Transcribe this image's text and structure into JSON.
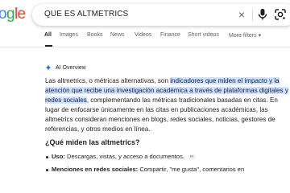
{
  "logo": {
    "part1": "o",
    "part2": "g",
    "part3": "le"
  },
  "search": {
    "query": "QUE ES ALTMETRICS",
    "clear": "×"
  },
  "tabs": [
    {
      "label": "All"
    },
    {
      "label": "Images"
    },
    {
      "label": "Books"
    },
    {
      "label": "News"
    },
    {
      "label": "Videos"
    },
    {
      "label": "Finance"
    },
    {
      "label": "Short videos"
    },
    {
      "label": "More filters"
    }
  ],
  "ai_overview": {
    "title": "AI Overview",
    "intro": "Las altmetrics, o métricas alternativas, son ",
    "highlight": "indicadores que miden el impacto y la atención que recibe una investigación académica a través de plataformas digitales y redes sociales",
    "rest": ", complementando las métricas tradicionales basadas en citas. En lugar de enfocarse únicamente en las citas en publicaciones académicas, las altmetrics consideran menciones en blogs, redes sociales, noticias, gestores de referencias, y otros medios en línea.",
    "question": "¿Qué miden las altmetrics?",
    "bullets": [
      {
        "term": "Uso:",
        "text": " Descargas, vistas, y acceso a documentos."
      },
      {
        "term": "Menciones en redes sociales:",
        "text": " Compartir, \"me gusta\", comentarios en"
      }
    ]
  },
  "colors": {
    "accent": "#1a73e8",
    "highlight": "#d3e3fd"
  }
}
